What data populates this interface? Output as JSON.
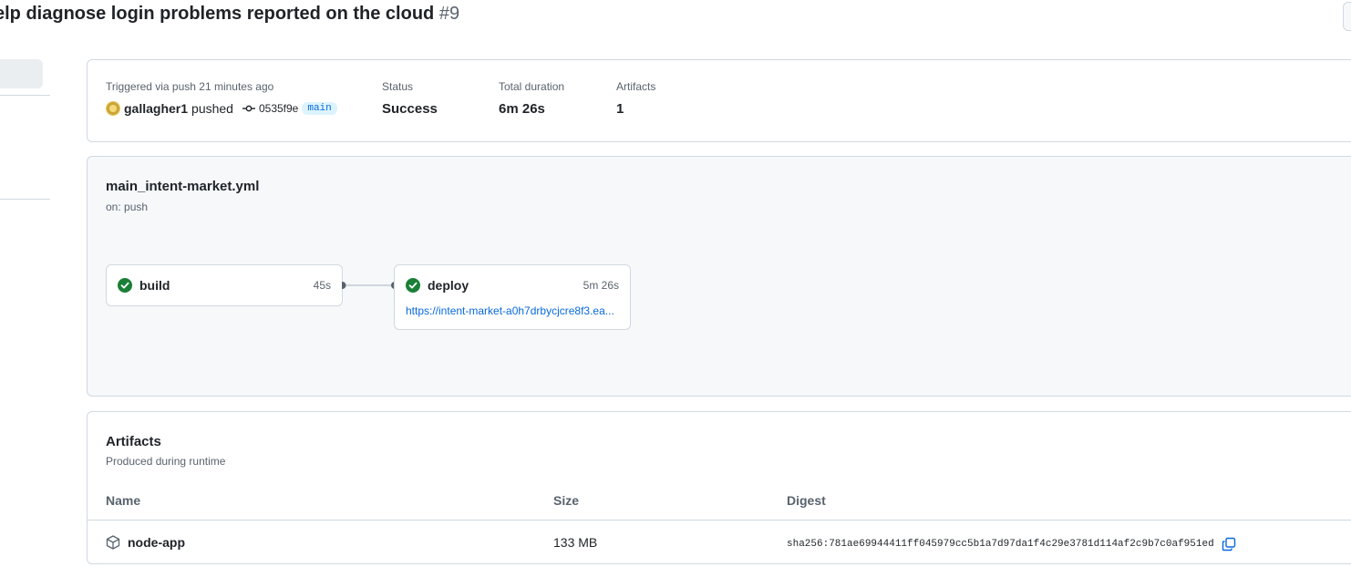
{
  "header": {
    "title": "elp diagnose login problems reported on the cloud",
    "run_number": "#9"
  },
  "summary": {
    "trigger_label": "Triggered via push 21 minutes ago",
    "actor": "gallagher1",
    "action": "pushed",
    "commit_sha": "0535f9e",
    "branch": "main",
    "status_label": "Status",
    "status_value": "Success",
    "duration_label": "Total duration",
    "duration_value": "6m 26s",
    "artifacts_label": "Artifacts",
    "artifacts_value": "1"
  },
  "workflow": {
    "file": "main_intent-market.yml",
    "trigger": "on: push",
    "jobs": [
      {
        "name": "build",
        "duration": "45s",
        "status": "success"
      },
      {
        "name": "deploy",
        "duration": "5m 26s",
        "status": "success",
        "url": "https://intent-market-a0h7drbycjcre8f3.ea..."
      }
    ]
  },
  "artifacts": {
    "title": "Artifacts",
    "subtitle": "Produced during runtime",
    "columns": {
      "name": "Name",
      "size": "Size",
      "digest": "Digest"
    },
    "rows": [
      {
        "name": "node-app",
        "size": "133 MB",
        "digest": "sha256:781ae69944411ff045979cc5b1a7d97da1f4c29e3781d114af2c9b7c0af951ed"
      }
    ]
  },
  "colors": {
    "success": "#1a7f37",
    "link": "#0969da",
    "border": "#d1d9e0",
    "muted": "#59636e"
  },
  "icons": [
    "check-circle-icon",
    "git-commit-icon",
    "package-icon",
    "copy-icon"
  ]
}
